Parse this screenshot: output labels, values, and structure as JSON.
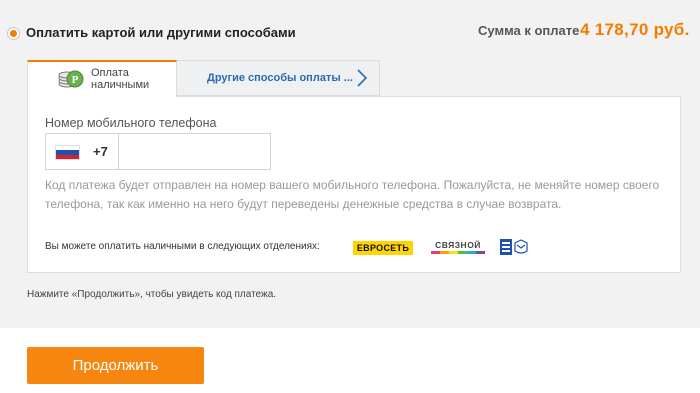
{
  "payment_option": {
    "title": "Оплатить картой или другими способами",
    "selected": true
  },
  "total": {
    "label": "Сумма к оплате",
    "value": "4 178,70 руб."
  },
  "tabs": [
    {
      "label_line1": "Оплата",
      "label_line2": "наличными",
      "icon": "cash-coins-icon",
      "active": true
    },
    {
      "label": "Другие способы оплаты ...",
      "icon": "chevron-right-icon",
      "active": false
    }
  ],
  "phone": {
    "label": "Номер мобильного телефона",
    "country_flag": "russia-flag-icon",
    "prefix": "+7",
    "value": "",
    "placeholder": ""
  },
  "hint": "Код платежа будет отправлен на номер вашего мобильного телефона. Пожалуйста, не меняйте номер своего телефона, так как именно на него будут переведены денежные средства в случае возврата.",
  "branches": {
    "text": "Вы можете оплатить наличными в следующих отделениях:",
    "logos": [
      {
        "name": "ЕВРОСЕТЬ",
        "color": "#ffd400"
      },
      {
        "name": "СВЯЗНОЙ",
        "color": "#444444"
      },
      {
        "name": "Почта России",
        "color": "#1f4fb0"
      }
    ]
  },
  "footer_note": "Нажмите «Продолжить», чтобы увидеть код платежа.",
  "continue_button": "Продолжить",
  "colors": {
    "accent": "#f57c00",
    "button": "#f6860f",
    "link": "#2a6cb0",
    "hint_text": "#999999"
  }
}
